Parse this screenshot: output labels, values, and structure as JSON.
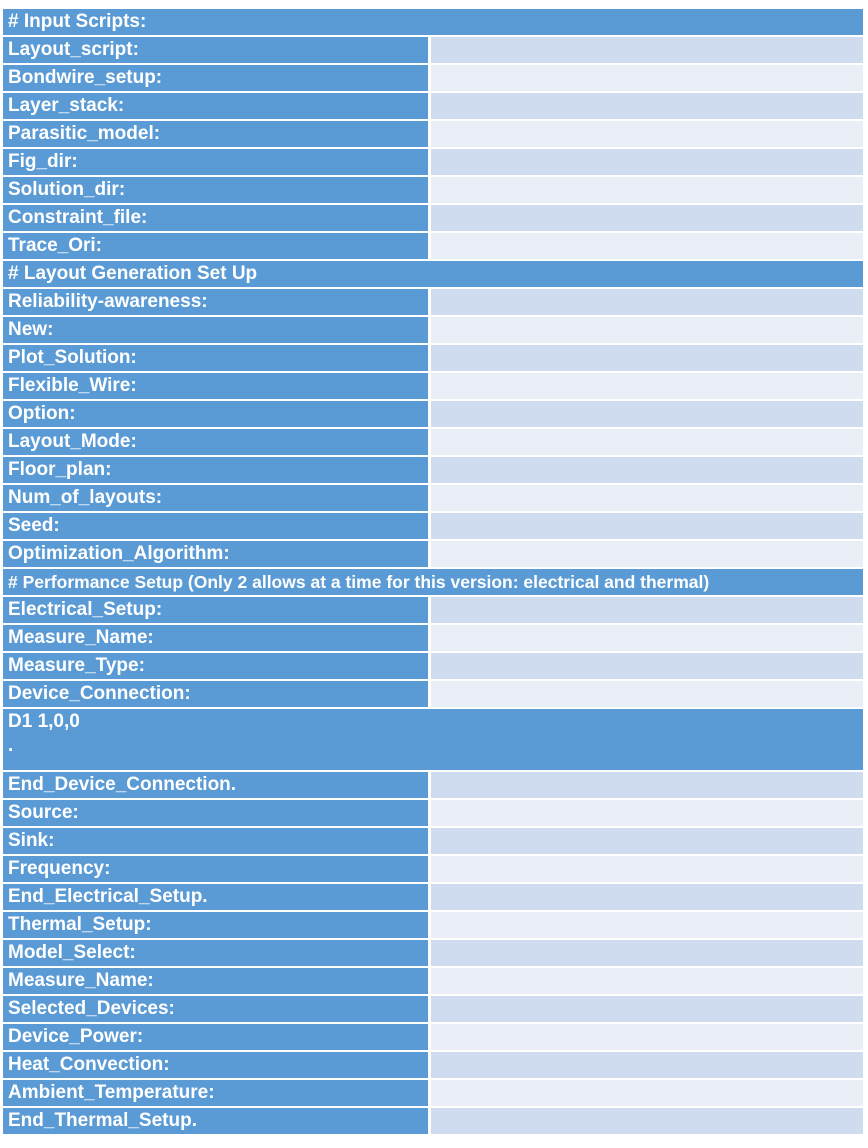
{
  "sections": {
    "input_scripts": "# Input Scripts:",
    "layout_generation": "# Layout Generation Set Up",
    "performance": "# Performance Setup (Only 2 allows at a time for this version: electrical and thermal)"
  },
  "input_rows": [
    "Layout_script:",
    "Bondwire_setup:",
    "Layer_stack:",
    "Parasitic_model:",
    "Fig_dir:",
    "Solution_dir:",
    "Constraint_file:",
    "Trace_Ori:"
  ],
  "layout_rows": [
    "Reliability-awareness:",
    "New:",
    "Plot_Solution:",
    "Flexible_Wire:",
    "Option:",
    "Layout_Mode:",
    "Floor_plan:",
    "Num_of_layouts:",
    "Seed:",
    "Optimization_Algorithm:"
  ],
  "electrical_rows": [
    "Electrical_Setup:",
    "Measure_Name:",
    "Measure_Type:",
    "Device_Connection:"
  ],
  "device_block": {
    "line1": "D1 1,0,0",
    "line2": "."
  },
  "post_rows": [
    "End_Device_Connection.",
    "Source:",
    "Sink:",
    "Frequency:",
    "End_Electrical_Setup.",
    "Thermal_Setup:",
    "Model_Select:",
    "Measure_Name:",
    "Selected_Devices:",
    "Device_Power:",
    "Heat_Convection:",
    "Ambient_Temperature:",
    "End_Thermal_Setup."
  ],
  "colors": {
    "label_bg": "#5b9bd5",
    "value_bg_dark": "#cfdcef",
    "value_bg_light": "#e9eef7"
  }
}
